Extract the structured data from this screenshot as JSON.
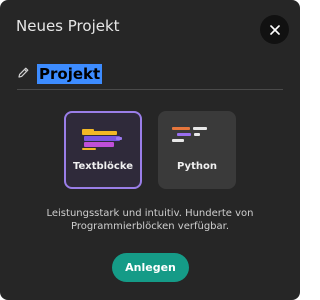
{
  "dialog": {
    "title": "Neues Projekt",
    "close_icon": "close-icon"
  },
  "project_name": {
    "edit_icon": "pencil-icon",
    "value": "Projekt"
  },
  "options": [
    {
      "label": "Textblöcke",
      "icon": "blocks-icon",
      "selected": true
    },
    {
      "label": "Python",
      "icon": "code-icon",
      "selected": false
    }
  ],
  "description": "Leistungsstark und intuitiv. Hunderte von Programmierblöcken verfügbar.",
  "create_button": {
    "label": "Anlegen"
  },
  "colors": {
    "accent": "#159b87",
    "selection_border": "#9a7ee8",
    "text_highlight": "#3d8cff"
  }
}
